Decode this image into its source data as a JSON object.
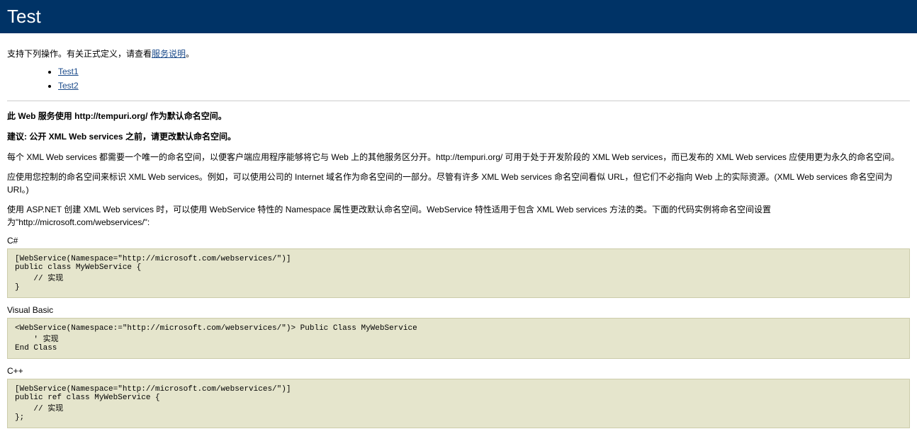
{
  "header": {
    "title": "Test"
  },
  "intro": {
    "prefix": "支持下列操作。有关正式定义，请查看",
    "link": "服务说明",
    "suffix": "。"
  },
  "operations": [
    {
      "name": "Test1"
    },
    {
      "name": "Test2"
    }
  ],
  "namespace_heading": "此 Web 服务使用 http://tempuri.org/ 作为默认命名空间。",
  "suggestion": "建议: 公开 XML Web services 之前，请更改默认命名空间。",
  "para1": "每个 XML Web services 都需要一个唯一的命名空间，以便客户端应用程序能够将它与 Web 上的其他服务区分开。http://tempuri.org/ 可用于处于开发阶段的 XML Web services，而已发布的 XML Web services 应使用更为永久的命名空间。",
  "para2": "应使用您控制的命名空间来标识 XML Web services。例如，可以使用公司的 Internet 域名作为命名空间的一部分。尽管有许多 XML Web services 命名空间看似 URL，但它们不必指向 Web 上的实际资源。(XML Web services 命名空间为 URI。)",
  "para3": "使用 ASP.NET 创建 XML Web services 时，可以使用 WebService 特性的 Namespace 属性更改默认命名空间。WebService 特性适用于包含 XML Web services 方法的类。下面的代码实例将命名空间设置为\"http://microsoft.com/webservices/\":",
  "samples": [
    {
      "lang": "C#",
      "code": "[WebService(Namespace=\"http://microsoft.com/webservices/\")]\npublic class MyWebService {\n    // 实现\n}"
    },
    {
      "lang": "Visual Basic",
      "code": "<WebService(Namespace:=\"http://microsoft.com/webservices/\")> Public Class MyWebService\n    ' 实现\nEnd Class"
    },
    {
      "lang": "C++",
      "code": "[WebService(Namespace=\"http://microsoft.com/webservices/\")]\npublic ref class MyWebService {\n    // 实现\n};"
    }
  ]
}
